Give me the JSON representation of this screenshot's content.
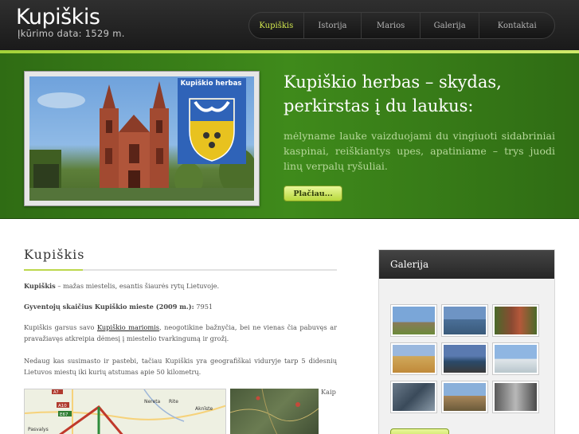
{
  "header": {
    "logo_title": "Kupiškis",
    "logo_subtitle": "Įkūrimo data: 1529 m."
  },
  "nav": {
    "items": [
      {
        "label": "Kupiškis",
        "active": true
      },
      {
        "label": "Istorija",
        "active": false
      },
      {
        "label": "Marios",
        "active": false
      },
      {
        "label": "Galerija",
        "active": false
      },
      {
        "label": "Kontaktai",
        "active": false
      }
    ]
  },
  "banner": {
    "image_caption": "Kupiškio herbas",
    "title": "Kupiškio herbas – skydas, perkirstas į du laukus:",
    "text": "mėlyname lauke vaizduojami du vingiuoti sidabriniai kaspinai, reiškiantys upes, apatiniame – trys juodi linų verpalų ryšuliai.",
    "more_label": "Plačiau..."
  },
  "content": {
    "title": "Kupiškis",
    "p1_bold": "Kupiškis",
    "p1_rest": " – mažas miestelis, esantis šiaurės rytų Lietuvoje.",
    "p2_bold": "Gyventojų skaičius Kupiškio mieste (2009 m.):",
    "p2_value": " 7951",
    "p3_before": "Kupiškis garsus savo ",
    "p3_link": "Kupiškio mariomis",
    "p3_after": ", neogotikine bažnyčia, bei ne vienas čia pabuvęs ar pravažiavęs atkreipia dėmesį į miestelio tvarkingumą ir grožį.",
    "p4": "Nedaug kas susimasto ir pastebi, tačiau Kupiškis yra geografiškai viduryje tarp 5 didesnių Lietuvos miestų iki kurių atstumas apie 50 kilometrų.",
    "map_labels": [
      "A7",
      "A10",
      "E67",
      "Pasvalys",
      "Nereta",
      "Rite",
      "Aknīste"
    ],
    "trailing_text": "Kaip"
  },
  "sidebar": {
    "title": "Galerija"
  }
}
